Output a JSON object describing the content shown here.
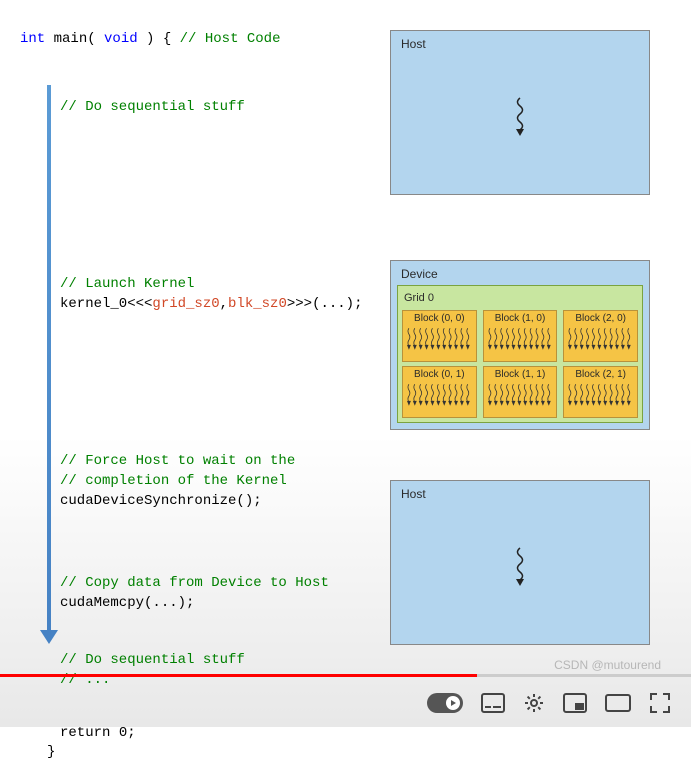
{
  "code": {
    "line1_int": "int",
    "line1_main": " main( ",
    "line1_void": "void",
    "line1_rest": " ) { ",
    "line1_comment": "// Host Code",
    "comment_seq1": "// Do sequential stuff",
    "comment_launch": "// Launch Kernel",
    "kernel_call_pre": "kernel_0<<<",
    "kernel_grid": "grid_sz0",
    "kernel_comma": ",",
    "kernel_blk": "blk_sz0",
    "kernel_call_post": ">>>(...);",
    "comment_force1": "// Force Host to wait on the",
    "comment_force2": "// completion of the Kernel",
    "sync_call": "cudaDeviceSynchronize();",
    "comment_copy": "// Copy data from Device to Host",
    "memcpy_call": "cudaMemcpy(...);",
    "comment_seq2": "// Do sequential stuff",
    "comment_dots": "// ...",
    "return_kw": "return",
    "return_val": " 0;",
    "close_brace": "}"
  },
  "diagram": {
    "host_label": "Host",
    "device_label": "Device",
    "grid_label": "Grid 0",
    "blocks": [
      [
        {
          "label": "Block (0, 0)"
        },
        {
          "label": "Block (1, 0)"
        },
        {
          "label": "Block (2, 0)"
        }
      ],
      [
        {
          "label": "Block (0, 1)"
        },
        {
          "label": "Block (1, 1)"
        },
        {
          "label": "Block (2, 1)"
        }
      ]
    ]
  },
  "watermark": "CSDN @mutourend"
}
